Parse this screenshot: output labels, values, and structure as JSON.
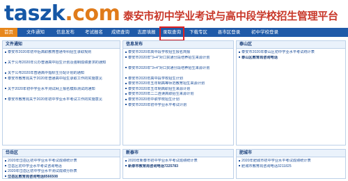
{
  "header": {
    "logo_main": "taszk",
    "logo_tld": ".com",
    "site_title": "泰安市初中学业考试与高中段学校招生管理平台"
  },
  "nav": {
    "items": [
      "首页",
      "文件通知",
      "信息发布",
      "考试报名",
      "成绩查询",
      "志愿填报",
      "录取查询",
      "下载专区",
      "县市区登录",
      "初中学校登录"
    ],
    "active_index": 0,
    "highlighted_index": 6
  },
  "panels": {
    "wenjian": {
      "title": "文件通知",
      "items": [
        "泰安市2020年初中后高职教育普通专科招生录取规则",
        "关于公布2020年公办普通高中招生计划及强制成绩要求的通知",
        "关于公布2020年普通高中指标生分配计划的通知",
        "泰安市教育局关于2020年普通高中招生录取工作的实施意见",
        "关于2020年初中学业水平测试网上报名模拟测试的通知",
        "泰安市教育局关于2020年初中学业水平考试工作的实施意见"
      ]
    },
    "xinxi": {
      "title": "信息发布",
      "items": [
        "泰安市2020年高中段学校招生报名简报",
        "泰安市2020年\"3+4\"对口贯通分段培养招生来源计划",
        "泰安市2020年\"3+4\"对口贯通分段培养招生来源计划",
        "泰安市2020年高中段学校招生计划",
        "泰安市2020年五年制高等师范教育招生来源计划",
        "泰安市2020年五年制高职招生来源计划",
        "泰安市2020年二二连读高职招生来源计划",
        "泰安市2020年中职学校招生计划",
        "泰安市2020年初中学业水平考试计划"
      ]
    },
    "taishan": {
      "title": "泰山区",
      "items": [
        "泰安市2020年泰山区初中学业水平考试统计表",
        "泰山区教育局咨询电话"
      ]
    },
    "daiyue": {
      "title": "岱岳区",
      "items": [
        "2020年岱岳区初中学业水平考试成绩统计表",
        "岱岳区初中学业水平考试咨询电话",
        "2020年岱岳区初中学业水平测试成绩分析表",
        "岱岳区教育局咨询电话8566508"
      ]
    },
    "xintai": {
      "title": "新泰市",
      "items": [
        "2020年新泰市初中学业水平考试成绩统计表",
        "新泰市教育局咨询电话7225783"
      ]
    },
    "feicheng": {
      "title": "肥城市",
      "items": [
        "2020年肥城市初中学业水平考试成绩统计表",
        "肥城市教育局咨询电话3211825"
      ]
    }
  },
  "colors": {
    "brand_blue": "#1f5aa8",
    "active_orange": "#e7871c",
    "title_red": "#c8382a",
    "highlight_red": "#e02020"
  }
}
